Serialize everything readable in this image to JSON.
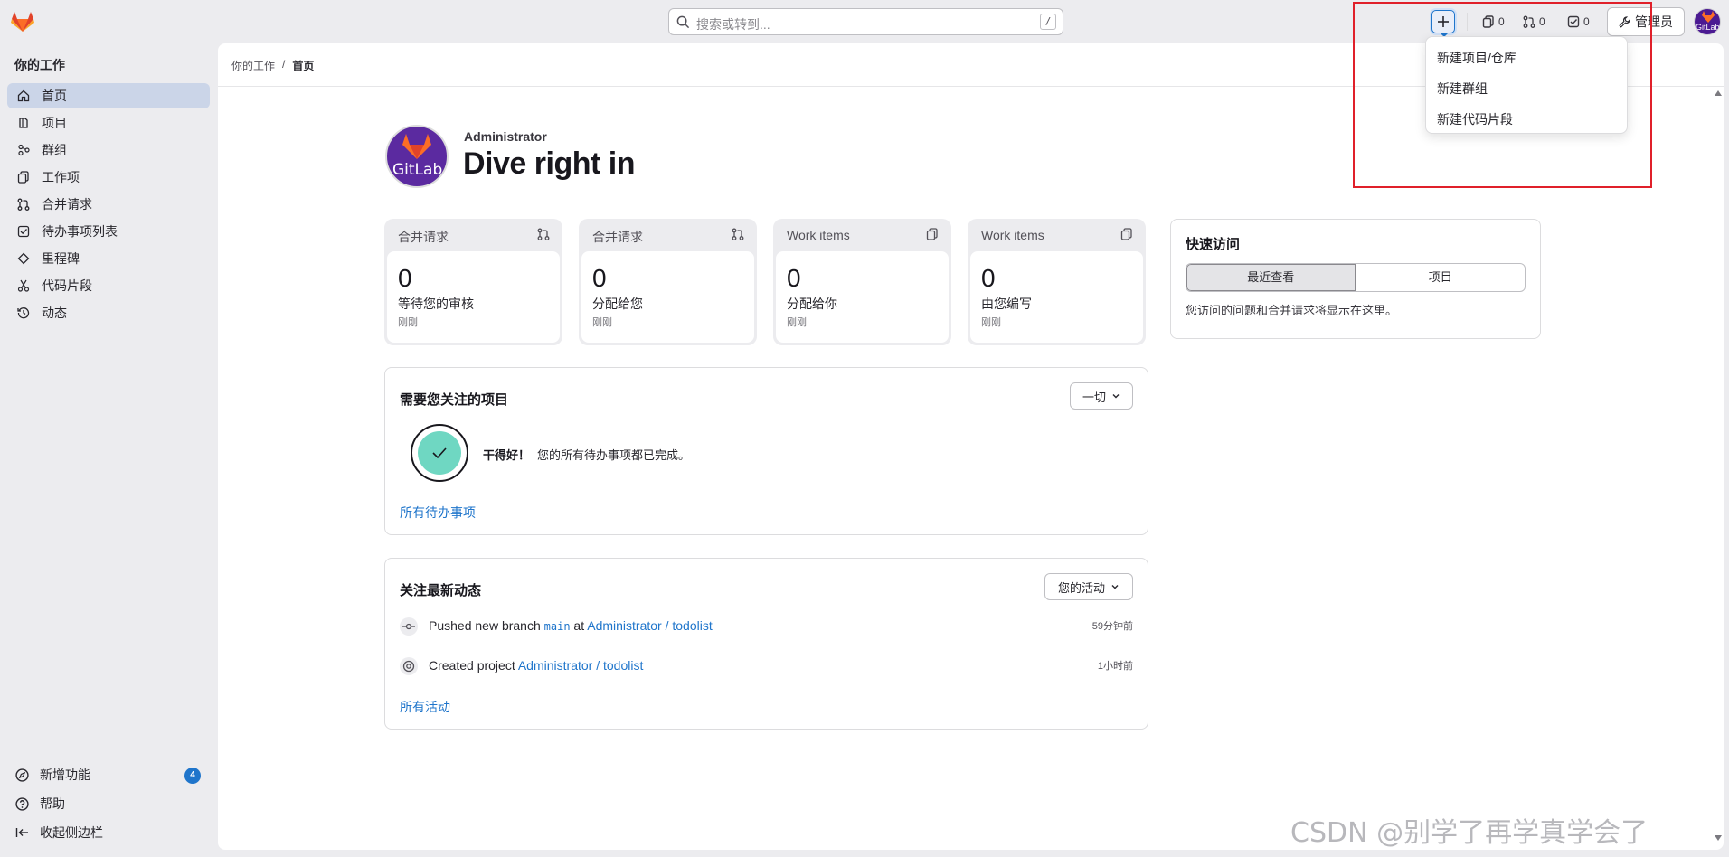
{
  "topbar": {
    "search_placeholder": "搜索或转到...",
    "search_shortcut": "/",
    "counters": {
      "issues": "0",
      "merge_requests": "0",
      "todos": "0"
    },
    "admin_label": "管理员",
    "avatar_text": "GitLab"
  },
  "new_menu": {
    "items": [
      "新建项目/仓库",
      "新建群组",
      "新建代码片段"
    ]
  },
  "sidebar": {
    "heading": "你的工作",
    "items": [
      {
        "label": "首页",
        "icon": "home-icon",
        "active": true
      },
      {
        "label": "项目",
        "icon": "project-icon"
      },
      {
        "label": "群组",
        "icon": "group-icon"
      },
      {
        "label": "工作项",
        "icon": "work-items-icon"
      },
      {
        "label": "合并请求",
        "icon": "merge-request-icon"
      },
      {
        "label": "待办事项列表",
        "icon": "todo-icon"
      },
      {
        "label": "里程碑",
        "icon": "milestone-icon"
      },
      {
        "label": "代码片段",
        "icon": "snippet-icon"
      },
      {
        "label": "动态",
        "icon": "history-icon"
      }
    ],
    "bottom": {
      "whats_new": "新增功能",
      "whats_new_count": "4",
      "help": "帮助",
      "collapse": "收起侧边栏"
    }
  },
  "breadcrumb": {
    "parent": "你的工作",
    "separator": "/",
    "current": "首页"
  },
  "hero": {
    "username": "Administrator",
    "title": "Dive right in",
    "avatar_text": "GitLab"
  },
  "stats": [
    {
      "title": "合并请求",
      "value": "0",
      "label": "等待您的审核",
      "time": "刚刚",
      "icon": "merge-request-icon"
    },
    {
      "title": "合并请求",
      "value": "0",
      "label": "分配给您",
      "time": "刚刚",
      "icon": "merge-request-icon"
    },
    {
      "title": "Work items",
      "value": "0",
      "label": "分配给你",
      "time": "刚刚",
      "icon": "work-items-icon"
    },
    {
      "title": "Work items",
      "value": "0",
      "label": "由您编写",
      "time": "刚刚",
      "icon": "work-items-icon"
    }
  ],
  "attention": {
    "title": "需要您关注的项目",
    "filter": "一切",
    "empty_strong": "干得好！",
    "empty_text": "您的所有待办事项都已完成。",
    "link": "所有待办事项"
  },
  "activity": {
    "title": "关注最新动态",
    "filter": "您的活动",
    "rows": [
      {
        "prefix": "Pushed new branch ",
        "branch": "main",
        "mid": " at ",
        "target": "Administrator / todolist",
        "time": "59分钟前"
      },
      {
        "prefix": "Created project ",
        "target": "Administrator / todolist",
        "time": "1小时前"
      }
    ],
    "link": "所有活动"
  },
  "quick_access": {
    "title": "快速访问",
    "tabs": [
      "最近查看",
      "项目"
    ],
    "empty_text": "您访问的问题和合并请求将显示在这里。"
  },
  "watermark": "CSDN @别学了再学真学会了",
  "colors": {
    "accent": "#1f75cb",
    "highlight_box": "#e0202a",
    "success": "#6fd7c2"
  }
}
